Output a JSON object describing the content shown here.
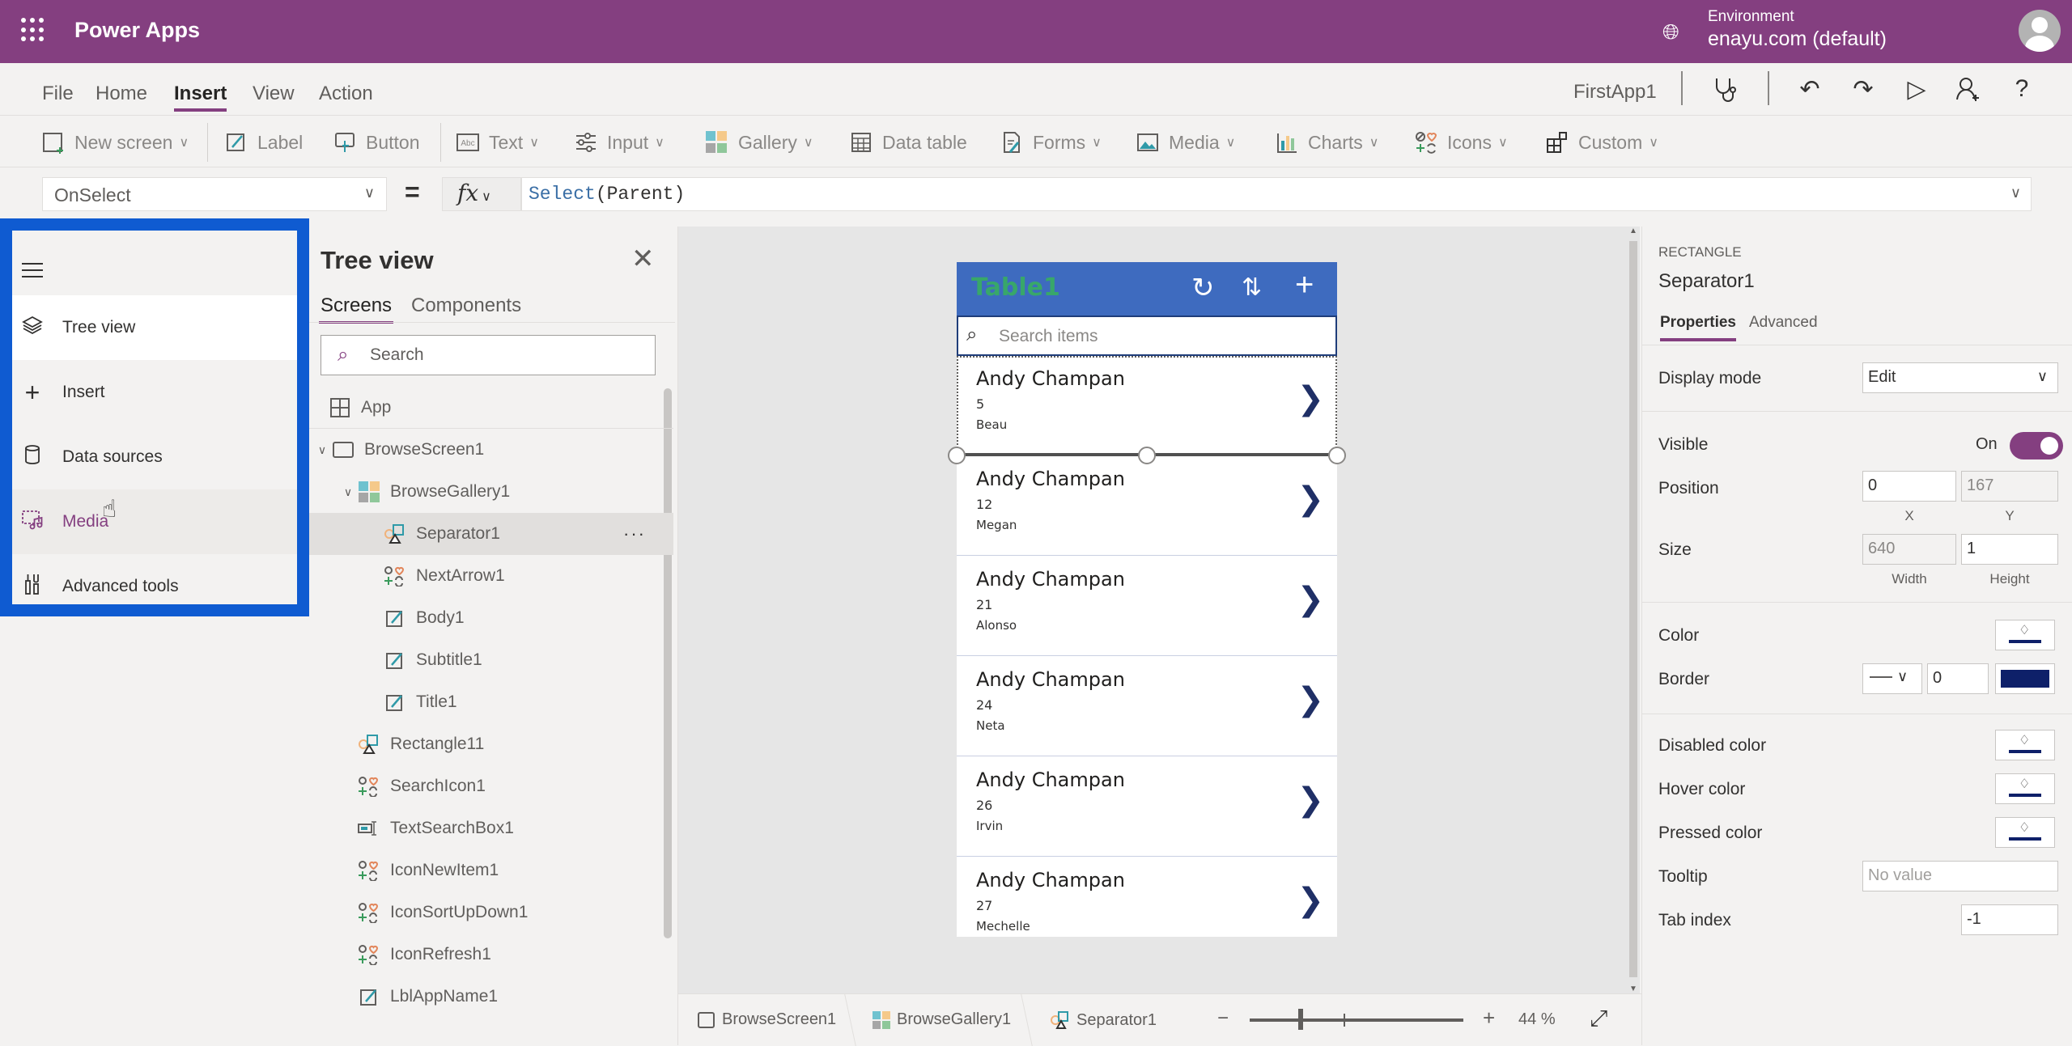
{
  "header": {
    "app_title": "Power Apps",
    "environment_label": "Environment",
    "environment_value": "enayu.com (default)"
  },
  "menu": {
    "items": [
      "File",
      "Home",
      "Insert",
      "View",
      "Action"
    ],
    "active": "Insert",
    "app_name": "FirstApp1"
  },
  "toolbar": {
    "new_screen": "New screen",
    "label": "Label",
    "button": "Button",
    "text": "Text",
    "input": "Input",
    "gallery": "Gallery",
    "data_table": "Data table",
    "forms": "Forms",
    "media": "Media",
    "charts": "Charts",
    "icons": "Icons",
    "custom": "Custom"
  },
  "formula_bar": {
    "property": "OnSelect",
    "equals": "=",
    "fx": "fx",
    "formula_fn": "Select",
    "formula_args": "(Parent)"
  },
  "left_nav": {
    "items": [
      {
        "label": "Tree view",
        "icon": "layers-icon"
      },
      {
        "label": "Insert",
        "icon": "plus-icon"
      },
      {
        "label": "Data sources",
        "icon": "database-icon"
      },
      {
        "label": "Media",
        "icon": "media-icon"
      },
      {
        "label": "Advanced tools",
        "icon": "tools-icon"
      }
    ],
    "selected": "Tree view",
    "hovered": "Media",
    "highlight_color": "#0f5bd1"
  },
  "tree_view": {
    "title": "Tree view",
    "tabs": [
      "Screens",
      "Components"
    ],
    "active_tab": "Screens",
    "search_placeholder": "Search",
    "nodes": [
      {
        "label": "App",
        "type": "app"
      },
      {
        "label": "BrowseScreen1",
        "type": "screen"
      },
      {
        "label": "BrowseGallery1",
        "type": "gallery"
      },
      {
        "label": "Separator1",
        "type": "shape",
        "selected": true
      },
      {
        "label": "NextArrow1",
        "type": "icon"
      },
      {
        "label": "Body1",
        "type": "label"
      },
      {
        "label": "Subtitle1",
        "type": "label"
      },
      {
        "label": "Title1",
        "type": "label"
      },
      {
        "label": "Rectangle11",
        "type": "shape"
      },
      {
        "label": "SearchIcon1",
        "type": "icon"
      },
      {
        "label": "TextSearchBox1",
        "type": "textinput"
      },
      {
        "label": "IconNewItem1",
        "type": "icon"
      },
      {
        "label": "IconSortUpDown1",
        "type": "icon"
      },
      {
        "label": "IconRefresh1",
        "type": "icon"
      },
      {
        "label": "LblAppName1",
        "type": "label"
      }
    ],
    "more": "···"
  },
  "phone": {
    "title": "Table1",
    "search_placeholder": "Search items",
    "items": [
      {
        "title": "Andy Champan",
        "subtitle": "5",
        "body": "Beau"
      },
      {
        "title": "Andy Champan",
        "subtitle": "12",
        "body": "Megan"
      },
      {
        "title": "Andy Champan",
        "subtitle": "21",
        "body": "Alonso"
      },
      {
        "title": "Andy Champan",
        "subtitle": "24",
        "body": "Neta"
      },
      {
        "title": "Andy Champan",
        "subtitle": "26",
        "body": "Irvin"
      },
      {
        "title": "Andy Champan",
        "subtitle": "27",
        "body": "Mechelle"
      }
    ],
    "header_color": "#3e6bbf"
  },
  "bottom_bar": {
    "breadcrumbs": [
      "BrowseScreen1",
      "BrowseGallery1",
      "Separator1"
    ],
    "zoom_value": "44",
    "zoom_unit": "%"
  },
  "properties": {
    "control_type": "RECTANGLE",
    "control_name": "Separator1",
    "tabs": [
      "Properties",
      "Advanced"
    ],
    "active_tab": "Properties",
    "display_mode_label": "Display mode",
    "display_mode_value": "Edit",
    "visible_label": "Visible",
    "visible_value": "On",
    "position_label": "Position",
    "position_x": "0",
    "position_y": "167",
    "x_label": "X",
    "y_label": "Y",
    "size_label": "Size",
    "width": "640",
    "height": "1",
    "width_label": "Width",
    "height_label": "Height",
    "color_label": "Color",
    "border_label": "Border",
    "border_width": "0",
    "border_color": "#0e2069",
    "disabled_color_label": "Disabled color",
    "hover_color_label": "Hover color",
    "pressed_color_label": "Pressed color",
    "tooltip_label": "Tooltip",
    "tooltip_placeholder": "No value",
    "tab_index_label": "Tab index",
    "tab_index_value": "-1"
  },
  "colors": {
    "brand": "#843f80",
    "fill_color": "#0e2069"
  }
}
